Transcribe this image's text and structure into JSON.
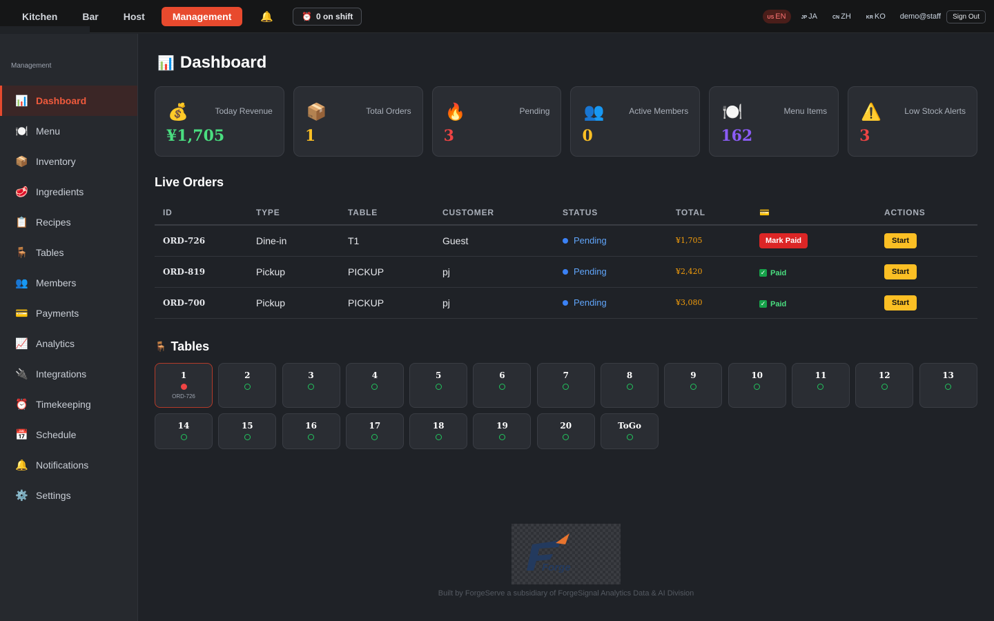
{
  "topnav": {
    "items": [
      "Kitchen",
      "Bar",
      "Host"
    ],
    "active": "Management",
    "shift": "0 on shift"
  },
  "languages": [
    {
      "flag": "US",
      "code": "EN"
    },
    {
      "flag": "JP",
      "code": "JA"
    },
    {
      "flag": "CN",
      "code": "ZH"
    },
    {
      "flag": "KR",
      "code": "KO"
    }
  ],
  "user": "demo@staff",
  "signout": "Sign Out",
  "sidebar": {
    "title": "Management",
    "items": [
      {
        "icon": "📊",
        "label": "Dashboard"
      },
      {
        "icon": "🍽️",
        "label": "Menu"
      },
      {
        "icon": "📦",
        "label": "Inventory"
      },
      {
        "icon": "🥩",
        "label": "Ingredients"
      },
      {
        "icon": "📋",
        "label": "Recipes"
      },
      {
        "icon": "🪑",
        "label": "Tables"
      },
      {
        "icon": "👥",
        "label": "Members"
      },
      {
        "icon": "💳",
        "label": "Payments"
      },
      {
        "icon": "📈",
        "label": "Analytics"
      },
      {
        "icon": "🔌",
        "label": "Integrations"
      },
      {
        "icon": "⏰",
        "label": "Timekeeping"
      },
      {
        "icon": "📅",
        "label": "Schedule"
      },
      {
        "icon": "🔔",
        "label": "Notifications"
      },
      {
        "icon": "⚙️",
        "label": "Settings"
      }
    ]
  },
  "page_title": "Dashboard",
  "cards": [
    {
      "icon": "💰",
      "label": "Today Revenue",
      "value": "¥1,705",
      "color": "#4ade80"
    },
    {
      "icon": "📦",
      "label": "Total Orders",
      "value": "1",
      "color": "#fbbf24"
    },
    {
      "icon": "🔥",
      "label": "Pending",
      "value": "3",
      "color": "#ef4444"
    },
    {
      "icon": "👥",
      "label": "Active Members",
      "value": "0",
      "color": "#fbbf24"
    },
    {
      "icon": "🍽️",
      "label": "Menu Items",
      "value": "162",
      "color": "#8b5cf6"
    },
    {
      "icon": "⚠️",
      "label": "Low Stock Alerts",
      "value": "3",
      "color": "#ef4444"
    }
  ],
  "live_orders": {
    "title": "Live Orders",
    "columns": [
      "ID",
      "TYPE",
      "TABLE",
      "CUSTOMER",
      "STATUS",
      "TOTAL",
      "💳",
      "ACTIONS"
    ],
    "rows": [
      {
        "id": "ORD-726",
        "type": "Dine-in",
        "table": "T1",
        "customer": "Guest",
        "status": "Pending",
        "total": "¥1,705",
        "payment": "Mark Paid",
        "paid": false,
        "action": "Start"
      },
      {
        "id": "ORD-819",
        "type": "Pickup",
        "table": "PICKUP",
        "customer": "pj",
        "status": "Pending",
        "total": "¥2,420",
        "payment": "Paid",
        "paid": true,
        "action": "Start"
      },
      {
        "id": "ORD-700",
        "type": "Pickup",
        "table": "PICKUP",
        "customer": "pj",
        "status": "Pending",
        "total": "¥3,080",
        "payment": "Paid",
        "paid": true,
        "action": "Start"
      }
    ]
  },
  "tables_section": {
    "title": "Tables",
    "tables": [
      {
        "name": "1",
        "occupied": true,
        "order": "ORD-726"
      },
      {
        "name": "2"
      },
      {
        "name": "3"
      },
      {
        "name": "4"
      },
      {
        "name": "5"
      },
      {
        "name": "6"
      },
      {
        "name": "7"
      },
      {
        "name": "8"
      },
      {
        "name": "9"
      },
      {
        "name": "10"
      },
      {
        "name": "11"
      },
      {
        "name": "12"
      },
      {
        "name": "13"
      },
      {
        "name": "14"
      },
      {
        "name": "15"
      },
      {
        "name": "16"
      },
      {
        "name": "17"
      },
      {
        "name": "18"
      },
      {
        "name": "19"
      },
      {
        "name": "20"
      },
      {
        "name": "ToGo"
      }
    ]
  },
  "footer": {
    "logo_text": "Forge",
    "text": "Built by ForgeServe a subsidiary of ForgeSignal Analytics Data & AI Division"
  }
}
